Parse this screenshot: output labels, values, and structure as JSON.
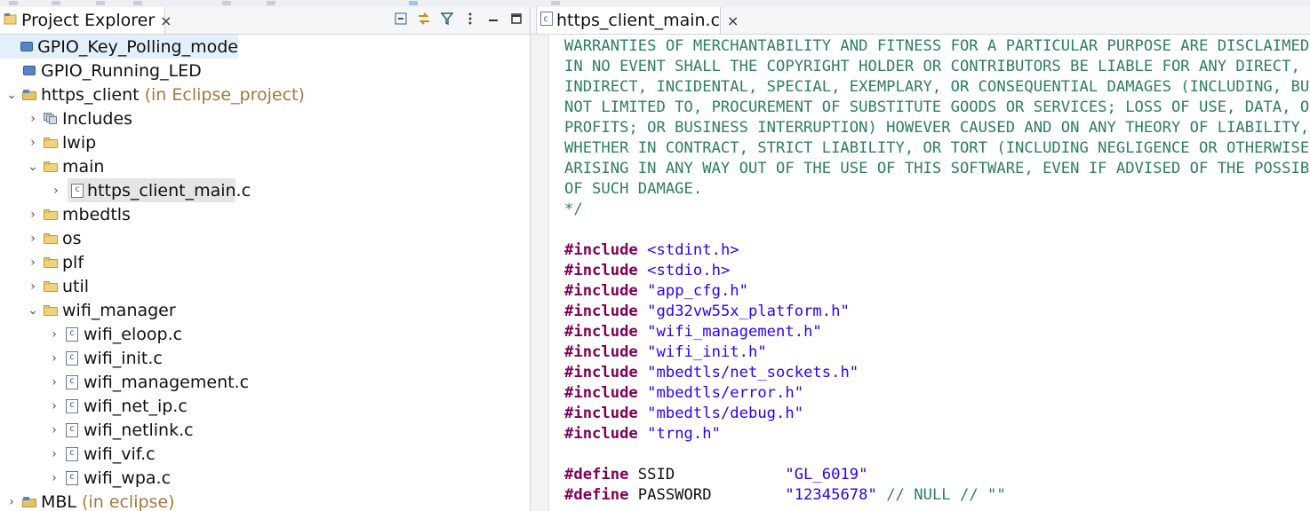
{
  "explorer": {
    "tab_title": "Project Explorer",
    "tab_close": "×",
    "tree": [
      {
        "label": "GPIO_Key_Polling_mode",
        "suffix": "",
        "icon": "project-closed-icon",
        "expanded": null,
        "depth": 0
      },
      {
        "label": "GPIO_Running_LED",
        "suffix": "",
        "icon": "project-closed-icon",
        "expanded": null,
        "depth": 0
      },
      {
        "label": "https_client",
        "suffix": "(in Eclipse_project)",
        "icon": "project-open-icon",
        "expanded": true,
        "depth": 0
      },
      {
        "label": "Includes",
        "suffix": "",
        "icon": "includes-icon",
        "expanded": false,
        "depth": 1
      },
      {
        "label": "lwip",
        "suffix": "",
        "icon": "folder-icon",
        "expanded": false,
        "depth": 1
      },
      {
        "label": "main",
        "suffix": "",
        "icon": "folder-icon",
        "expanded": true,
        "depth": 1
      },
      {
        "label": "https_client_main.c",
        "suffix": "",
        "icon": "c-file-icon",
        "expanded": false,
        "depth": 2
      },
      {
        "label": "mbedtls",
        "suffix": "",
        "icon": "folder-icon",
        "expanded": false,
        "depth": 1
      },
      {
        "label": "os",
        "suffix": "",
        "icon": "folder-icon",
        "expanded": false,
        "depth": 1
      },
      {
        "label": "plf",
        "suffix": "",
        "icon": "folder-icon",
        "expanded": false,
        "depth": 1
      },
      {
        "label": "util",
        "suffix": "",
        "icon": "folder-icon",
        "expanded": false,
        "depth": 1
      },
      {
        "label": "wifi_manager",
        "suffix": "",
        "icon": "folder-icon",
        "expanded": true,
        "depth": 1
      },
      {
        "label": "wifi_eloop.c",
        "suffix": "",
        "icon": "c-file-icon",
        "expanded": false,
        "depth": 2
      },
      {
        "label": "wifi_init.c",
        "suffix": "",
        "icon": "c-file-icon",
        "expanded": false,
        "depth": 2
      },
      {
        "label": "wifi_management.c",
        "suffix": "",
        "icon": "c-file-icon",
        "expanded": false,
        "depth": 2
      },
      {
        "label": "wifi_net_ip.c",
        "suffix": "",
        "icon": "c-file-icon",
        "expanded": false,
        "depth": 2
      },
      {
        "label": "wifi_netlink.c",
        "suffix": "",
        "icon": "c-file-icon",
        "expanded": false,
        "depth": 2
      },
      {
        "label": "wifi_vif.c",
        "suffix": "",
        "icon": "c-file-icon",
        "expanded": false,
        "depth": 2
      },
      {
        "label": "wifi_wpa.c",
        "suffix": "",
        "icon": "c-file-icon",
        "expanded": false,
        "depth": 2
      },
      {
        "label": "MBL",
        "suffix": "(in eclipse)",
        "icon": "project-open-icon",
        "expanded": false,
        "depth": 0
      }
    ]
  },
  "editor": {
    "tab_title": "https_client_main.c",
    "tab_close": "×",
    "code_lines": [
      [
        {
          "t": "cmt",
          "s": "WARRANTIES OF MERCHANTABILITY AND FITNESS FOR A PARTICULAR PURPOSE ARE DISCLAIMED."
        }
      ],
      [
        {
          "t": "cmt",
          "s": "IN NO EVENT SHALL THE COPYRIGHT HOLDER OR CONTRIBUTORS BE LIABLE FOR ANY DIRECT,"
        }
      ],
      [
        {
          "t": "cmt",
          "s": "INDIRECT, INCIDENTAL, SPECIAL, EXEMPLARY, OR CONSEQUENTIAL DAMAGES (INCLUDING, BUT"
        }
      ],
      [
        {
          "t": "cmt",
          "s": "NOT LIMITED TO, PROCUREMENT OF SUBSTITUTE GOODS OR SERVICES; LOSS OF USE, DATA, OR"
        }
      ],
      [
        {
          "t": "cmt",
          "s": "PROFITS; OR BUSINESS INTERRUPTION) HOWEVER CAUSED AND ON ANY THEORY OF LIABILITY,"
        }
      ],
      [
        {
          "t": "cmt",
          "s": "WHETHER IN CONTRACT, STRICT LIABILITY, OR TORT (INCLUDING NEGLIGENCE OR OTHERWISE)"
        }
      ],
      [
        {
          "t": "cmt",
          "s": "ARISING IN ANY WAY OUT OF THE USE OF THIS SOFTWARE, EVEN IF ADVISED OF THE POSSIBILITY"
        }
      ],
      [
        {
          "t": "cmt",
          "s": "OF SUCH DAMAGE."
        }
      ],
      [
        {
          "t": "cmt",
          "s": "*/"
        }
      ],
      [],
      [
        {
          "t": "kw",
          "s": "#include"
        },
        {
          "t": "plain",
          "s": " "
        },
        {
          "t": "str",
          "s": "<stdint.h>"
        }
      ],
      [
        {
          "t": "kw",
          "s": "#include"
        },
        {
          "t": "plain",
          "s": " "
        },
        {
          "t": "str",
          "s": "<stdio.h>"
        }
      ],
      [
        {
          "t": "kw",
          "s": "#include"
        },
        {
          "t": "plain",
          "s": " "
        },
        {
          "t": "str",
          "s": "\"app_cfg.h\""
        }
      ],
      [
        {
          "t": "kw",
          "s": "#include"
        },
        {
          "t": "plain",
          "s": " "
        },
        {
          "t": "str",
          "s": "\"gd32vw55x_platform.h\""
        }
      ],
      [
        {
          "t": "kw",
          "s": "#include"
        },
        {
          "t": "plain",
          "s": " "
        },
        {
          "t": "str",
          "s": "\"wifi_management.h\""
        }
      ],
      [
        {
          "t": "kw",
          "s": "#include"
        },
        {
          "t": "plain",
          "s": " "
        },
        {
          "t": "str",
          "s": "\"wifi_init.h\""
        }
      ],
      [
        {
          "t": "kw",
          "s": "#include"
        },
        {
          "t": "plain",
          "s": " "
        },
        {
          "t": "str",
          "s": "\"mbedtls/net_sockets.h\""
        }
      ],
      [
        {
          "t": "kw",
          "s": "#include"
        },
        {
          "t": "plain",
          "s": " "
        },
        {
          "t": "str",
          "s": "\"mbedtls/error.h\""
        }
      ],
      [
        {
          "t": "kw",
          "s": "#include"
        },
        {
          "t": "plain",
          "s": " "
        },
        {
          "t": "str",
          "s": "\"mbedtls/debug.h\""
        }
      ],
      [
        {
          "t": "kw",
          "s": "#include"
        },
        {
          "t": "plain",
          "s": " "
        },
        {
          "t": "str",
          "s": "\"trng.h\""
        }
      ],
      [],
      [
        {
          "t": "kw",
          "s": "#define"
        },
        {
          "t": "plain",
          "s": " SSID            "
        },
        {
          "t": "str",
          "s": "\"GL_6019\""
        }
      ],
      [
        {
          "t": "kw",
          "s": "#define"
        },
        {
          "t": "plain",
          "s": " PASSWORD        "
        },
        {
          "t": "str",
          "s": "\"12345678\""
        },
        {
          "t": "plain",
          "s": " "
        },
        {
          "t": "cmt",
          "s": "// NULL // \"\""
        }
      ]
    ]
  }
}
